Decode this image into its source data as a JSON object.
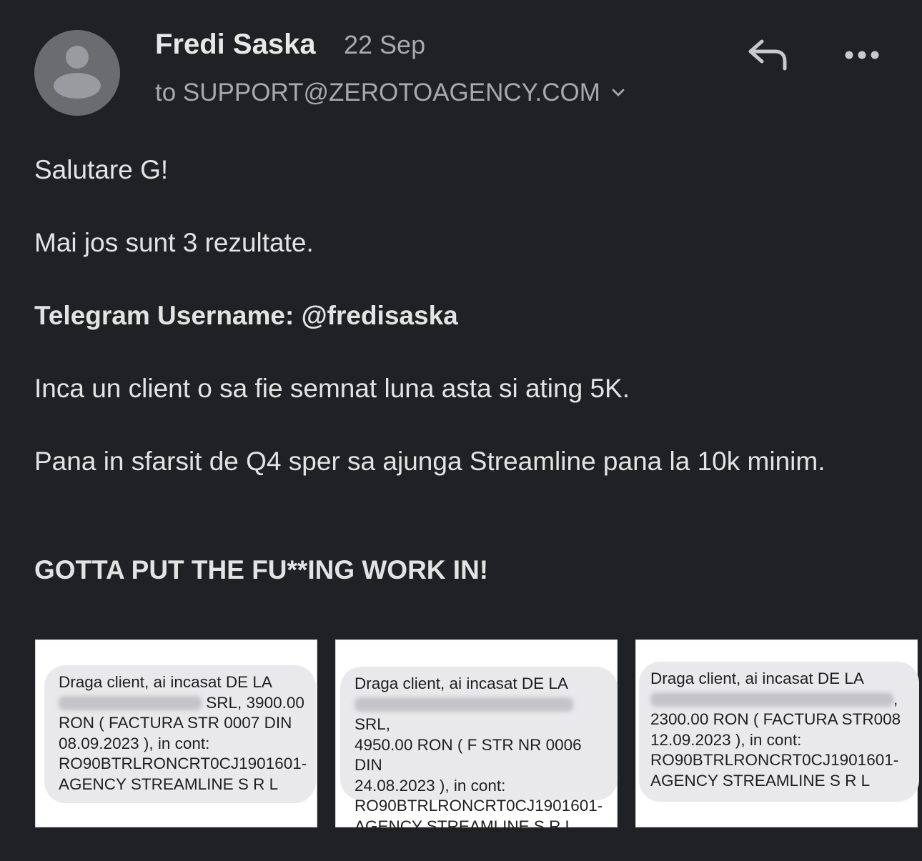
{
  "header": {
    "sender_name": "Fredi Saska",
    "date": "22 Sep",
    "recipient": "to SUPPORT@ZEROTOAGENCY.COM",
    "icons": [
      "avatar-icon",
      "chevron-down-icon",
      "reply-icon",
      "more-icon"
    ]
  },
  "message": {
    "greeting": "Salutare G!",
    "line1": "Mai jos sunt 3 rezultate.",
    "telegram": "Telegram Username: @fredisaska",
    "line2": "Inca un client o sa fie semnat luna asta si ating 5K.",
    "line3": "Pana in sfarsit de Q4 sper sa ajunga Streamline pana la 10k minim.",
    "closing": "GOTTA PUT THE FU**ING WORK IN!"
  },
  "attachments": [
    {
      "line1": "Draga client, ai incasat DE LA",
      "line2_after_blur": "SRL, 3900.00",
      "line3": "RON ( FACTURA STR 0007 DIN",
      "line4": "08.09.2023 ), in cont:",
      "line5": "RO90BTRLRONCRT0CJ1901601-",
      "line6": "AGENCY STREAMLINE S R L"
    },
    {
      "line1": "Draga client, ai incasat DE LA",
      "line2_after_blur": "SRL,",
      "line3": "4950.00 RON ( F STR NR 0006 DIN",
      "line4": "24.08.2023 ), in cont:",
      "line5": "RO90BTRLRONCRT0CJ1901601-",
      "line6": "AGENCY STREAMLINE S R L"
    },
    {
      "line1": "Draga client, ai incasat DE LA",
      "line2_after_blur": ",",
      "line3": "2300.00 RON ( FACTURA STR008",
      "line4": "12.09.2023 ), in cont:",
      "line5": "RO90BTRLRONCRT0CJ1901601-",
      "line6": "AGENCY STREAMLINE S R L"
    }
  ]
}
